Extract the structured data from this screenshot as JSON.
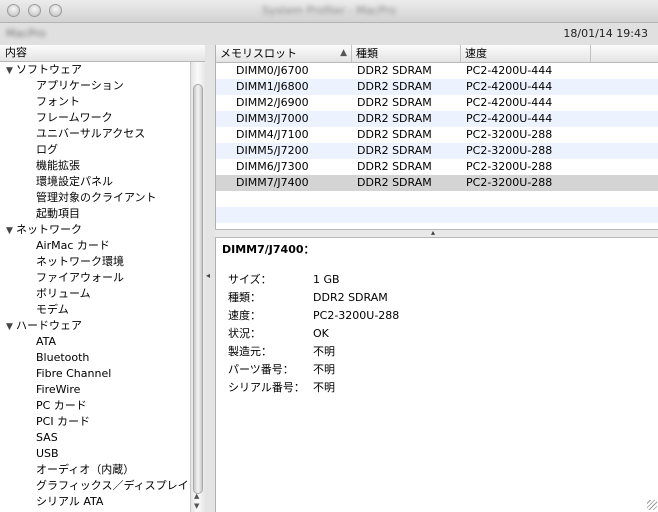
{
  "window": {
    "title": "System Profiler - MacPro",
    "machine_name": "MacPro"
  },
  "toolbar": {
    "datetime": "18/01/14 19:43"
  },
  "sidebar": {
    "header": "内容",
    "items": [
      {
        "label": "ソフトウェア",
        "type": "category"
      },
      {
        "label": "アプリケーション",
        "type": "leaf"
      },
      {
        "label": "フォント",
        "type": "leaf"
      },
      {
        "label": "フレームワーク",
        "type": "leaf"
      },
      {
        "label": "ユニバーサルアクセス",
        "type": "leaf"
      },
      {
        "label": "ログ",
        "type": "leaf"
      },
      {
        "label": "機能拡張",
        "type": "leaf"
      },
      {
        "label": "環境設定パネル",
        "type": "leaf"
      },
      {
        "label": "管理対象のクライアント",
        "type": "leaf"
      },
      {
        "label": "起動項目",
        "type": "leaf"
      },
      {
        "label": "ネットワーク",
        "type": "category"
      },
      {
        "label": "AirMac カード",
        "type": "leaf"
      },
      {
        "label": "ネットワーク環境",
        "type": "leaf"
      },
      {
        "label": "ファイアウォール",
        "type": "leaf"
      },
      {
        "label": "ボリューム",
        "type": "leaf"
      },
      {
        "label": "モデム",
        "type": "leaf"
      },
      {
        "label": "ハードウェア",
        "type": "category"
      },
      {
        "label": "ATA",
        "type": "leaf"
      },
      {
        "label": "Bluetooth",
        "type": "leaf"
      },
      {
        "label": "Fibre Channel",
        "type": "leaf"
      },
      {
        "label": "FireWire",
        "type": "leaf"
      },
      {
        "label": "PC カード",
        "type": "leaf"
      },
      {
        "label": "PCI カード",
        "type": "leaf"
      },
      {
        "label": "SAS",
        "type": "leaf"
      },
      {
        "label": "USB",
        "type": "leaf"
      },
      {
        "label": "オーディオ（内蔵）",
        "type": "leaf"
      },
      {
        "label": "グラフィックス／ディスプレイ",
        "type": "leaf"
      },
      {
        "label": "シリアル ATA",
        "type": "leaf"
      }
    ]
  },
  "table": {
    "columns": [
      "メモリスロット",
      "種類",
      "速度"
    ],
    "rows": [
      [
        "DIMM0/J6700",
        "DDR2 SDRAM",
        "PC2-4200U-444"
      ],
      [
        "DIMM1/J6800",
        "DDR2 SDRAM",
        "PC2-4200U-444"
      ],
      [
        "DIMM2/J6900",
        "DDR2 SDRAM",
        "PC2-4200U-444"
      ],
      [
        "DIMM3/J7000",
        "DDR2 SDRAM",
        "PC2-4200U-444"
      ],
      [
        "DIMM4/J7100",
        "DDR2 SDRAM",
        "PC2-3200U-288"
      ],
      [
        "DIMM5/J7200",
        "DDR2 SDRAM",
        "PC2-3200U-288"
      ],
      [
        "DIMM6/J7300",
        "DDR2 SDRAM",
        "PC2-3200U-288"
      ],
      [
        "DIMM7/J7400",
        "DDR2 SDRAM",
        "PC2-3200U-288"
      ]
    ],
    "selected_index": 7
  },
  "detail": {
    "title": "DIMM7/J7400：",
    "fields": [
      {
        "key": "サイズ：",
        "value": "1 GB"
      },
      {
        "key": "種類：",
        "value": "DDR2 SDRAM"
      },
      {
        "key": "速度：",
        "value": "PC2-3200U-288"
      },
      {
        "key": "状況：",
        "value": "OK"
      },
      {
        "key": "製造元：",
        "value": "不明"
      },
      {
        "key": "パーツ番号：",
        "value": "不明"
      },
      {
        "key": "シリアル番号：",
        "value": "不明"
      }
    ]
  },
  "colors": {
    "alt_row": "#edf3fe",
    "selected_row": "#d4d4d4"
  },
  "icons": {
    "sort": "sort-ascending-icon",
    "disclosure": "disclosure-triangle-icon",
    "splitter": "splitter-grip-icon"
  }
}
